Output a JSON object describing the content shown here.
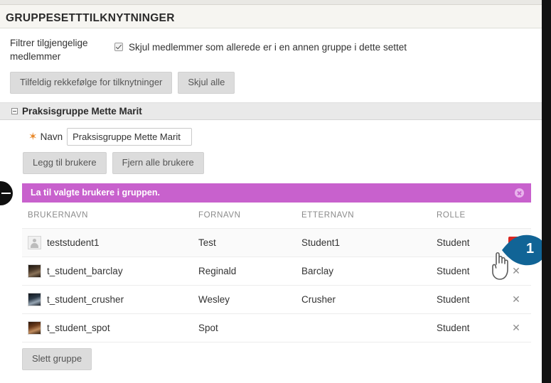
{
  "page": {
    "title": "GRUPPESETTTILKNYTNINGER"
  },
  "filter": {
    "label": "Filtrer tilgjengelige medlemmer",
    "checkbox_label": "Skjul medlemmer som allerede er i en annen gruppe i dette settet",
    "checkbox_checked": "true"
  },
  "toolbar": {
    "randomize_label": "Tilfeldig rekkefølge for tilknytninger",
    "hide_all_label": "Skjul alle"
  },
  "group": {
    "header_title": "Praksisgruppe Mette Marit",
    "name_label": "Navn",
    "name_required_marker": "✶",
    "name_value": "Praksisgruppe Mette Marit",
    "add_users_label": "Legg til brukere",
    "remove_all_users_label": "Fjern alle brukere",
    "delete_group_label": "Slett gruppe"
  },
  "notice": {
    "text": "La til valgte brukere i gruppen.",
    "close_icon": "close-circle-icon",
    "background_color": "#c861cd"
  },
  "table": {
    "headers": {
      "username": "BRUKERNAVN",
      "firstname": "FORNAVN",
      "lastname": "ETTERNAVN",
      "role": "ROLLE",
      "actions": ""
    },
    "rows": [
      {
        "avatar": "generic-user-avatar",
        "username": "teststudent1",
        "firstname": "Test",
        "lastname": "Student1",
        "role": "Student",
        "remove_icon": "remove-x-icon-highlighted"
      },
      {
        "avatar": "photo-avatar-barclay",
        "username": "t_student_barclay",
        "firstname": "Reginald",
        "lastname": "Barclay",
        "role": "Student",
        "remove_icon": "remove-x-icon"
      },
      {
        "avatar": "photo-avatar-crusher",
        "username": "t_student_crusher",
        "firstname": "Wesley",
        "lastname": "Crusher",
        "role": "Student",
        "remove_icon": "remove-x-icon"
      },
      {
        "avatar": "photo-avatar-spot",
        "username": "t_student_spot",
        "firstname": "Spot",
        "lastname": "",
        "role": "Student",
        "remove_icon": "remove-x-icon"
      }
    ],
    "remove_x_glyph": "✕"
  },
  "annotation": {
    "step_number": "1",
    "color": "#116496"
  },
  "edge_widget": {
    "icon": "collapse-minus-icon"
  }
}
